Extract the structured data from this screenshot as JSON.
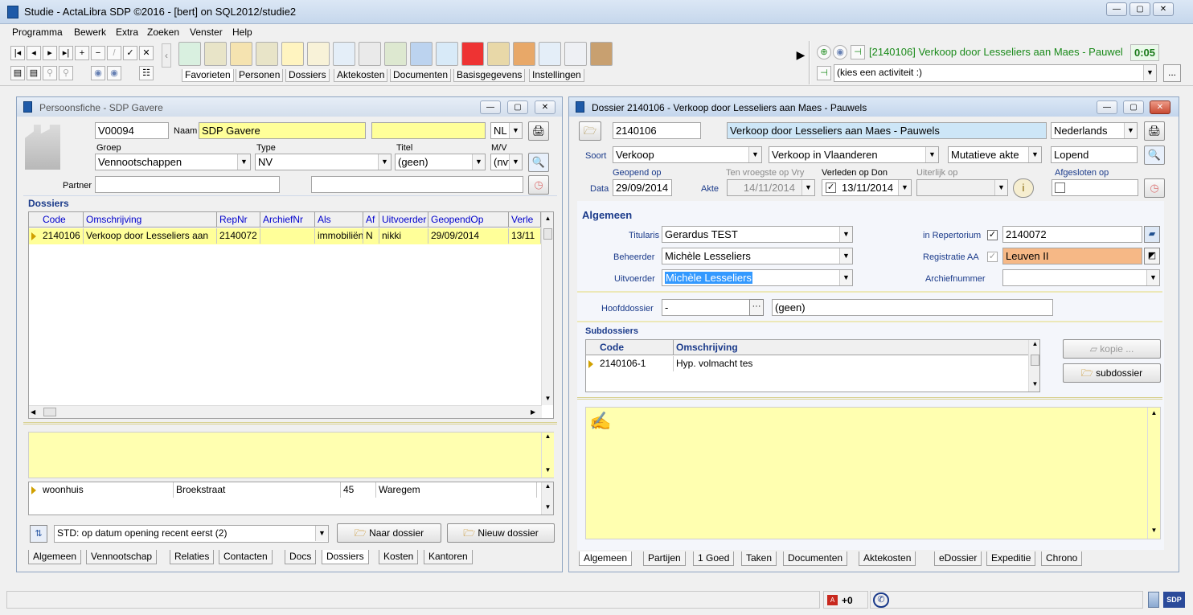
{
  "app": {
    "title": "Studie - ActaLibra  SDP ©2016 - [bert]  on  SQL2012/studie2"
  },
  "menu": [
    "Programma",
    "Bewerk",
    "Extra",
    "Zoeken",
    "Venster",
    "Help"
  ],
  "toolbar": {
    "tabs": [
      "Favorieten",
      "Personen",
      "Dossiers",
      "Aktekosten",
      "Documenten",
      "Basisgegevens",
      "Instellingen"
    ],
    "current_dossier": "[2140106] Verkoop door Lesseliers aan Maes - Pauwel",
    "timer": "0:05",
    "activity": "(kies een activiteit :)",
    "more": "..."
  },
  "left": {
    "title": "Persoonsfiche - SDP Gavere",
    "code": "V00094",
    "naam_label": "Naam",
    "naam": "SDP Gavere",
    "lang": "NL",
    "groep_label": "Groep",
    "groep": "Vennootschappen",
    "type_label": "Type",
    "type": "NV",
    "titel_label": "Titel",
    "titel": "(geen)",
    "mv_label": "M/V",
    "mv": "(nvt",
    "partner_label": "Partner",
    "dossiers_label": "Dossiers",
    "columns": [
      "Code",
      "Omschrijving",
      "RepNr",
      "ArchiefNr",
      "Als",
      "Af",
      "Uitvoerder",
      "GeopendOp",
      "Verle"
    ],
    "rows": [
      [
        "2140106",
        "Verkoop door Lesseliers aan",
        "2140072",
        "",
        "immobiliën",
        "N",
        "nikki",
        "29/09/2014",
        "13/11"
      ]
    ],
    "addr_rows": [
      [
        "woonhuis",
        "Broekstraat",
        "45",
        "Waregem"
      ]
    ],
    "sort": "STD: op datum opening recent eerst (2)",
    "naar_dossier": "Naar dossier",
    "nieuw_dossier": "Nieuw dossier",
    "tabs": [
      "Algemeen",
      "Vennootschap",
      "Relaties",
      "Contacten",
      "Docs",
      "Dossiers",
      "Kosten",
      "Kantoren"
    ]
  },
  "right": {
    "title": "Dossier 2140106 - Verkoop door Lesseliers aan Maes - Pauwels",
    "code": "2140106",
    "omschrijving": "Verkoop door Lesseliers aan Maes - Pauwels",
    "taal": "Nederlands",
    "soort_label": "Soort",
    "soort": "Verkoop",
    "soort2": "Verkoop in Vlaanderen",
    "soort3": "Mutatieve akte",
    "status": "Lopend",
    "geopend_label": "Geopend op",
    "vroegste_label": "Ten vroegste op Vry",
    "verleden_label": "Verleden op Don",
    "uiterlijk_label": "Uiterlijk op",
    "afgesloten_label": "Afgesloten op",
    "data_label": "Data",
    "akte_label": "Akte",
    "geopend": "29/09/2014",
    "vroegste": "14/11/2014",
    "verleden": "13/11/2014",
    "algemeen_label": "Algemeen",
    "titularis_label": "Titularis",
    "titularis": "Gerardus TEST",
    "beheerder_label": "Beheerder",
    "beheerder": "Michèle Lesseliers",
    "uitvoerder_label": "Uitvoerder",
    "uitvoerder": "Michèle Lesseliers",
    "repertorium_label": "in Repertorium",
    "repertorium": "2140072",
    "registratie_label": "Registratie AA",
    "registratie": "Leuven II",
    "archief_label": "Archiefnummer",
    "hoofd_label": "Hoofddossier",
    "hoofd": "-",
    "hoofd_desc": "(geen)",
    "subdossiers_label": "Subdossiers",
    "sub_columns": [
      "Code",
      "Omschrijving"
    ],
    "sub_rows": [
      [
        "2140106-1",
        "Hyp. volmacht tes"
      ]
    ],
    "kopie": "kopie ...",
    "subdossier": "subdossier",
    "tabs": [
      "Algemeen",
      "Partijen",
      "1 Goed",
      "Taken",
      "Documenten",
      "Aktekosten",
      "eDossier",
      "Expeditie",
      "Chrono"
    ]
  },
  "status": {
    "count": "+0"
  }
}
